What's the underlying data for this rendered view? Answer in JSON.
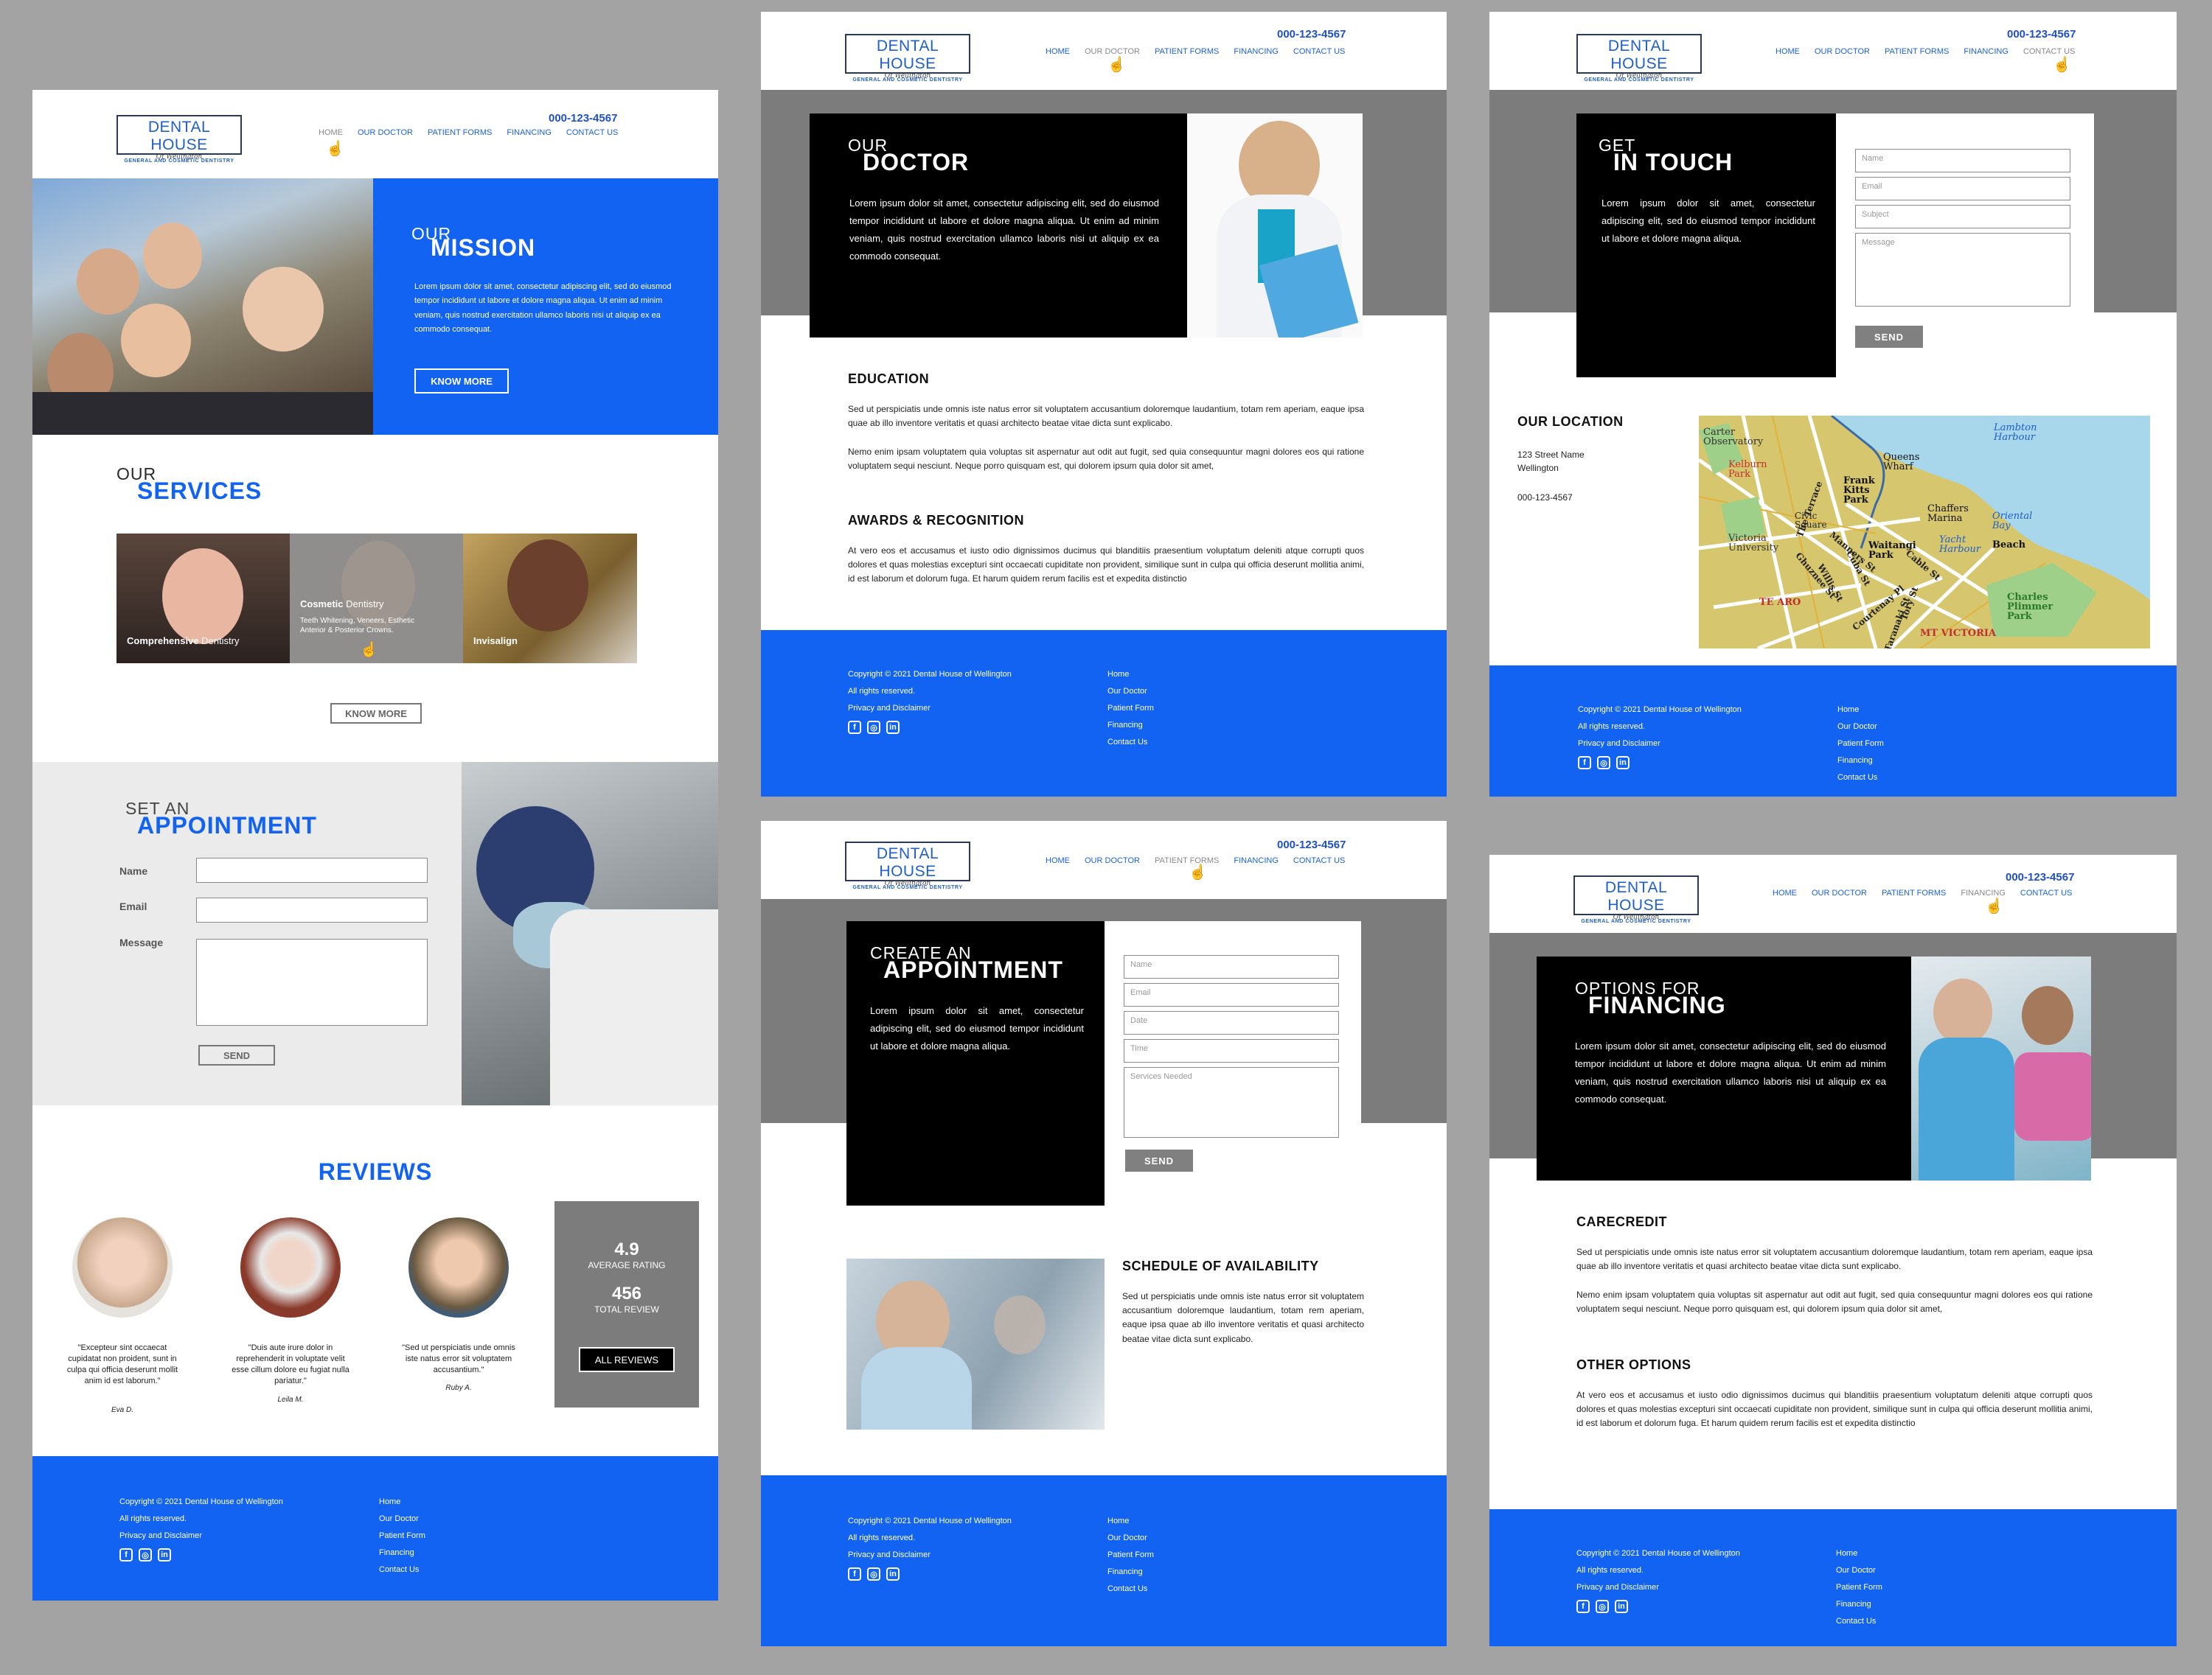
{
  "brand": {
    "name": "DENTAL HOUSE",
    "sub": "Of Wellington",
    "tagline": "GENERAL AND COSMETIC DENTISTRY",
    "phone": "000-123-4567"
  },
  "nav": [
    "HOME",
    "OUR DOCTOR",
    "PATIENT FORMS",
    "FINANCING",
    "CONTACT US"
  ],
  "footer": {
    "copyright": "Copyright © 2021 Dental House of Wellington",
    "rights": "All rights reserved.",
    "privacy": "Privacy and Disclaimer",
    "links": [
      "Home",
      "Our Doctor",
      "Patient Form",
      "Financing",
      "Contact Us"
    ]
  },
  "lorem_short": "Lorem ipsum dolor sit amet, consectetur adipiscing elit, sed do eiusmod tempor incididunt ut labore et dolore magna aliqua.",
  "lorem_long": "Lorem ipsum dolor sit amet, consectetur adipiscing elit, sed do eiusmod tempor incididunt ut labore et dolore magna aliqua. Ut enim ad minim veniam, quis nostrud exercitation ullamco laboris nisi ut aliquip ex ea commodo consequat.",
  "sed_ut": "Sed ut perspiciatis unde omnis iste natus error sit voluptatem accusantium doloremque laudantium, totam rem aperiam, eaque ipsa quae ab illo inventore veritatis et quasi architecto beatae vitae dicta sunt explicabo.",
  "nemo": "Nemo enim ipsam voluptatem quia voluptas sit aspernatur aut odit aut fugit, sed quia consequuntur magni dolores eos qui ratione voluptatem sequi nesciunt. Neque porro quisquam est, qui dolorem ipsum quia dolor sit amet,",
  "at_vero": "At vero eos et accusamus et iusto odio dignissimos ducimus qui blanditiis praesentium voluptatum deleniti atque corrupti quos dolores et quas molestias excepturi sint occaecati cupiditate non provident, similique sunt in culpa qui officia deserunt mollitia animi, id est laborum et dolorum fuga. Et harum quidem rerum facilis est et expedita distinctio",
  "home": {
    "mission_small": "OUR",
    "mission_big": "MISSION",
    "know_more": "KNOW MORE",
    "services_small": "OUR",
    "services_big": "SERVICES",
    "services": [
      {
        "bold": "Comprehensive",
        "rest": " Dentistry",
        "desc": ""
      },
      {
        "bold": "Cosmetic",
        "rest": " Dentistry",
        "desc": "Teeth Whitening, Veneers, Esthetic Anterior & Posterior Crowns."
      },
      {
        "bold": "Invisalign",
        "rest": "",
        "desc": ""
      }
    ],
    "appt_small": "SET AN",
    "appt_big": "APPOINTMENT",
    "labels": {
      "name": "Name",
      "email": "Email",
      "message": "Message"
    },
    "send": "SEND",
    "reviews_title": "REVIEWS",
    "reviews": [
      {
        "quote": "\"Excepteur sint occaecat cupidatat non proident, sunt in culpa qui officia deserunt mollit anim id est laborum.\"",
        "author": "Eva D."
      },
      {
        "quote": "\"Duis aute irure dolor in reprehenderit in voluptate velit esse cillum dolore eu fugiat nulla pariatur.\"",
        "author": "Leila M."
      },
      {
        "quote": "\"Sed ut perspiciatis unde omnis iste natus error sit voluptatem accusantium.\"",
        "author": "Ruby A."
      }
    ],
    "rating": "4.9",
    "rating_label": "AVERAGE RATING",
    "total": "456",
    "total_label": "TOTAL REVIEW",
    "all_reviews": "ALL REVIEWS"
  },
  "doctor": {
    "small": "OUR",
    "big": "DOCTOR",
    "education": "EDUCATION",
    "awards": "AWARDS & RECOGNITION"
  },
  "contact": {
    "small": "GET",
    "big": "IN TOUCH",
    "ph": {
      "name": "Name",
      "email": "Email",
      "subject": "Subject",
      "message": "Message"
    },
    "send": "SEND",
    "location_title": "OUR LOCATION",
    "address1": "123 Street Name",
    "address2": "Wellington",
    "phone": "000-123-4567",
    "map_labels": [
      "Carter Observatory",
      "Kelburn Park",
      "Victoria University",
      "The Terrace",
      "Willis St",
      "Cuba St",
      "Civic Square",
      "Queens Wharf",
      "Frank Kitts Park",
      "Chaffers Marina",
      "Lambton Harbour",
      "Oriental Bay",
      "Waitangi Park",
      "Yacht Harbour",
      "Beach",
      "Cable St",
      "Courtenay Pl",
      "Charles Plimmer Park",
      "MT VICTORIA",
      "TE ARO",
      "Ghuznee St",
      "Taranaki St",
      "Tory St",
      "Manners St"
    ]
  },
  "forms": {
    "small": "CREATE AN",
    "big": "APPOINTMENT",
    "ph": {
      "name": "Name",
      "email": "Email",
      "date": "Date",
      "time": "Time",
      "services": "Services Needed"
    },
    "send": "SEND",
    "schedule_title": "SCHEDULE OF AVAILABILITY",
    "schedule_text": "Sed ut perspiciatis unde omnis iste natus error sit voluptatem accusantium doloremque laudantium, totam rem aperiam, eaque ipsa quae ab illo inventore veritatis et quasi architecto beatae vitae dicta sunt explicabo."
  },
  "financing": {
    "small": "OPTIONS FOR",
    "big": "FINANCING",
    "carecredit": "CARECREDIT",
    "other": "OTHER OPTIONS"
  },
  "colors": {
    "accent": "#1263f1",
    "dark": "#000000",
    "grey": "#7c7c7c"
  }
}
